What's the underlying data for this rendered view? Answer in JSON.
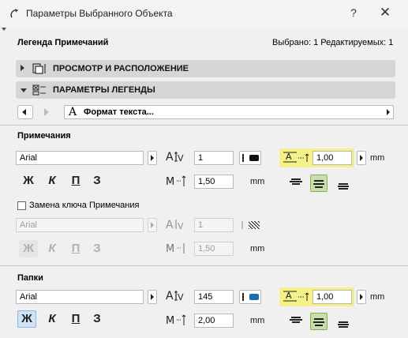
{
  "window": {
    "title": "Параметры Выбранного Объекта",
    "help": "?",
    "close": "✕"
  },
  "header": {
    "left": "Легенда Примечаний",
    "right": "Выбрано: 1 Редактируемых: 1"
  },
  "sections": [
    {
      "label": "ПРОСМОТР И РАСПОЛОЖЕНИЕ",
      "expanded": false
    },
    {
      "label": "ПАРАМЕТРЫ ЛЕГЕНДЫ",
      "expanded": true
    }
  ],
  "panel_selector": {
    "label": "Формат текста...",
    "icon_glyph": "A"
  },
  "notes": {
    "heading": "Примечания",
    "font": "Arial",
    "size": "1",
    "line_spacing": "1,00",
    "line_spacing_unit": "mm",
    "width_factor": "1,50",
    "width_unit": "mm",
    "color": "#111111",
    "style_bold": "Ж",
    "style_italic": "К",
    "style_underline": "П",
    "style_strike": "З"
  },
  "override": {
    "checkbox_label": "Замена ключа Примечания",
    "checked": false,
    "font": "Arial",
    "size": "1",
    "width_factor": "1,50",
    "width_unit": "mm",
    "style_bold": "Ж",
    "style_italic": "К",
    "style_underline": "П",
    "style_strike": "З"
  },
  "folders": {
    "heading": "Папки",
    "font": "Arial",
    "size": "145",
    "line_spacing": "1,00",
    "line_spacing_unit": "mm",
    "width_factor": "2,00",
    "width_unit": "mm",
    "color": "#1e6fb0",
    "style_bold": "Ж",
    "style_italic": "К",
    "style_underline": "П",
    "style_strike": "З"
  }
}
